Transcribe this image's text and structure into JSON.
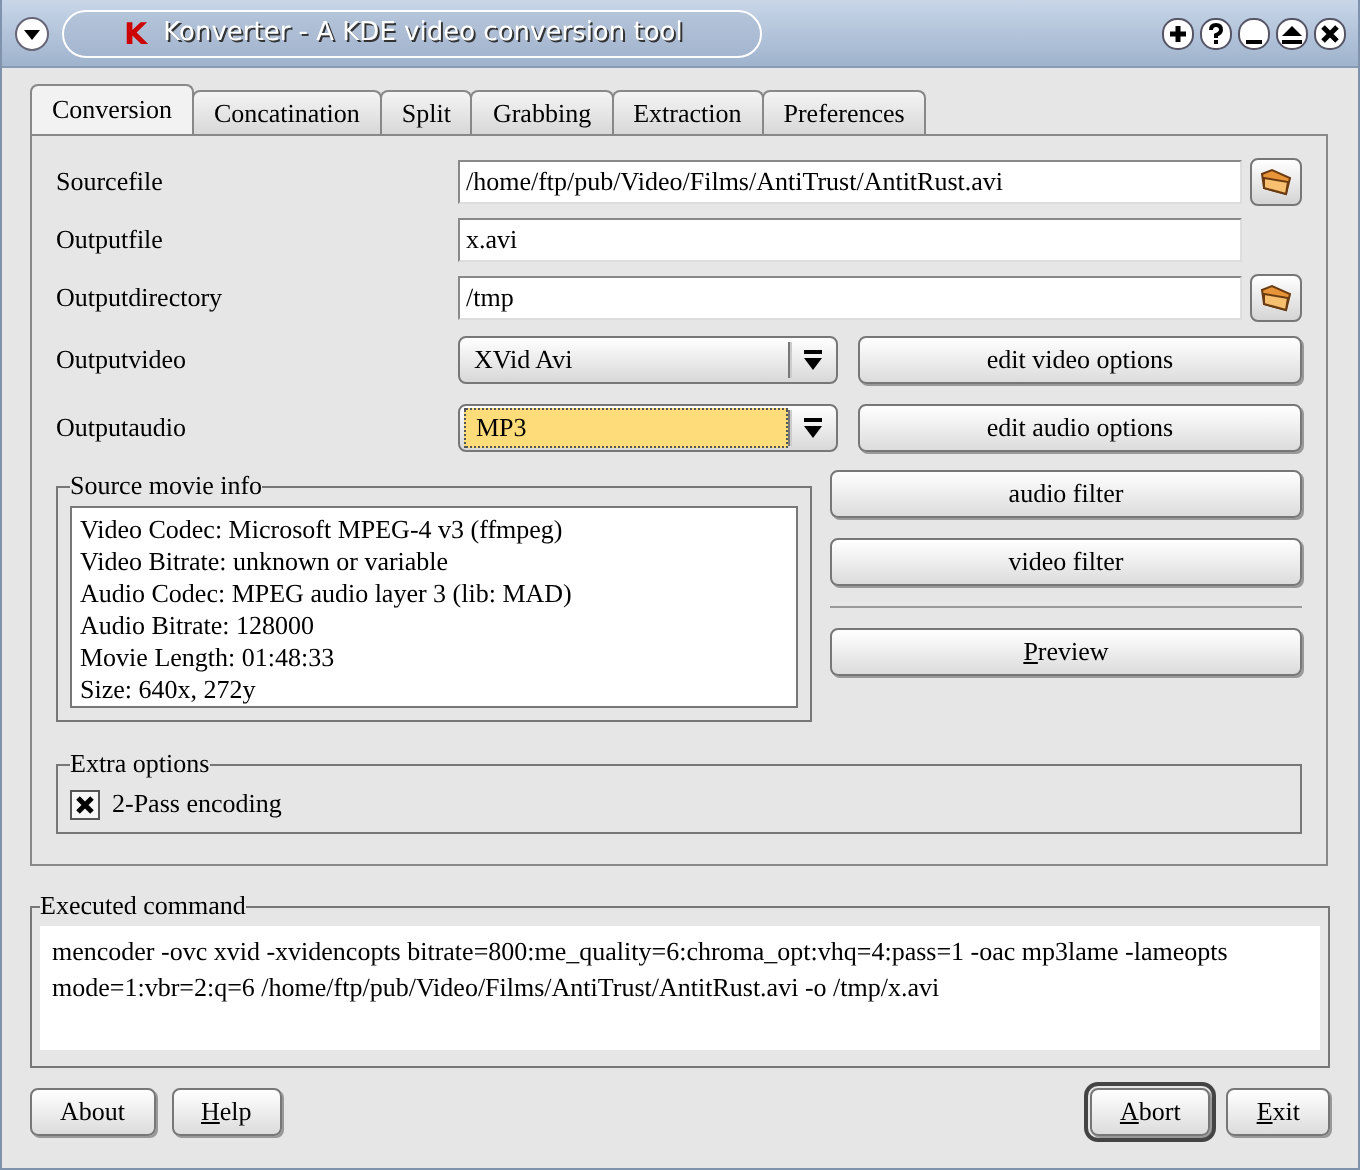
{
  "window": {
    "logo": "K",
    "title": "Konverter - A KDE video conversion tool"
  },
  "tabs": [
    {
      "label": "Conversion",
      "selected": true
    },
    {
      "label": "Concatination",
      "selected": false
    },
    {
      "label": "Split",
      "selected": false
    },
    {
      "label": "Grabbing",
      "selected": false
    },
    {
      "label": "Extraction",
      "selected": false
    },
    {
      "label": "Preferences",
      "selected": false
    }
  ],
  "form": [
    {
      "kind": "file",
      "label": "Sourcefile",
      "value": "/home/ftp/pub/Video/Films/AntiTrust/AntitRust.avi"
    },
    {
      "kind": "text",
      "label": "Outputfile",
      "value": "x.avi"
    },
    {
      "kind": "file",
      "label": "Outputdirectory",
      "value": "/tmp"
    },
    {
      "kind": "combo",
      "label": "Outputvideo",
      "value": "XVid Avi",
      "focused": false,
      "button": "edit video options"
    },
    {
      "kind": "combo",
      "label": "Outputaudio",
      "value": "MP3",
      "focused": true,
      "button": "edit audio options"
    }
  ],
  "source_movie_info": {
    "title": "Source movie info",
    "lines": [
      "Video Codec: Microsoft MPEG-4 v3 (ffmpeg)",
      "Video Bitrate: unknown or variable",
      "Audio Codec: MPEG audio layer 3 (lib: MAD)",
      "Audio Bitrate: 128000",
      "Movie Length: 01:48:33",
      "Size: 640x, 272y"
    ]
  },
  "filter_buttons": [
    {
      "label": "audio filter",
      "accel": false
    },
    {
      "label": "video filter",
      "accel": false
    }
  ],
  "preview_button": {
    "label": "Preview",
    "accel": true
  },
  "extra_options": {
    "title": "Extra options",
    "checkbox": {
      "label": "2-Pass encoding",
      "checked": true
    }
  },
  "executed_command": {
    "title": "Executed command",
    "text": "mencoder -ovc xvid -xvidencopts bitrate=800:me_quality=6:chroma_opt:vhq=4:pass=1 -oac mp3lame -lameopts mode=1:vbr=2:q=6 /home/ftp/pub/Video/Films/AntiTrust/AntitRust.avi -o /tmp/x.avi"
  },
  "bottom_left_buttons": [
    {
      "label": "About",
      "accel": false,
      "default": false
    },
    {
      "label": "Help",
      "accel": true,
      "default": false
    }
  ],
  "bottom_right_buttons": [
    {
      "label": "Abort",
      "accel": true,
      "default": true
    },
    {
      "label": "Exit",
      "accel": true,
      "default": false
    }
  ]
}
